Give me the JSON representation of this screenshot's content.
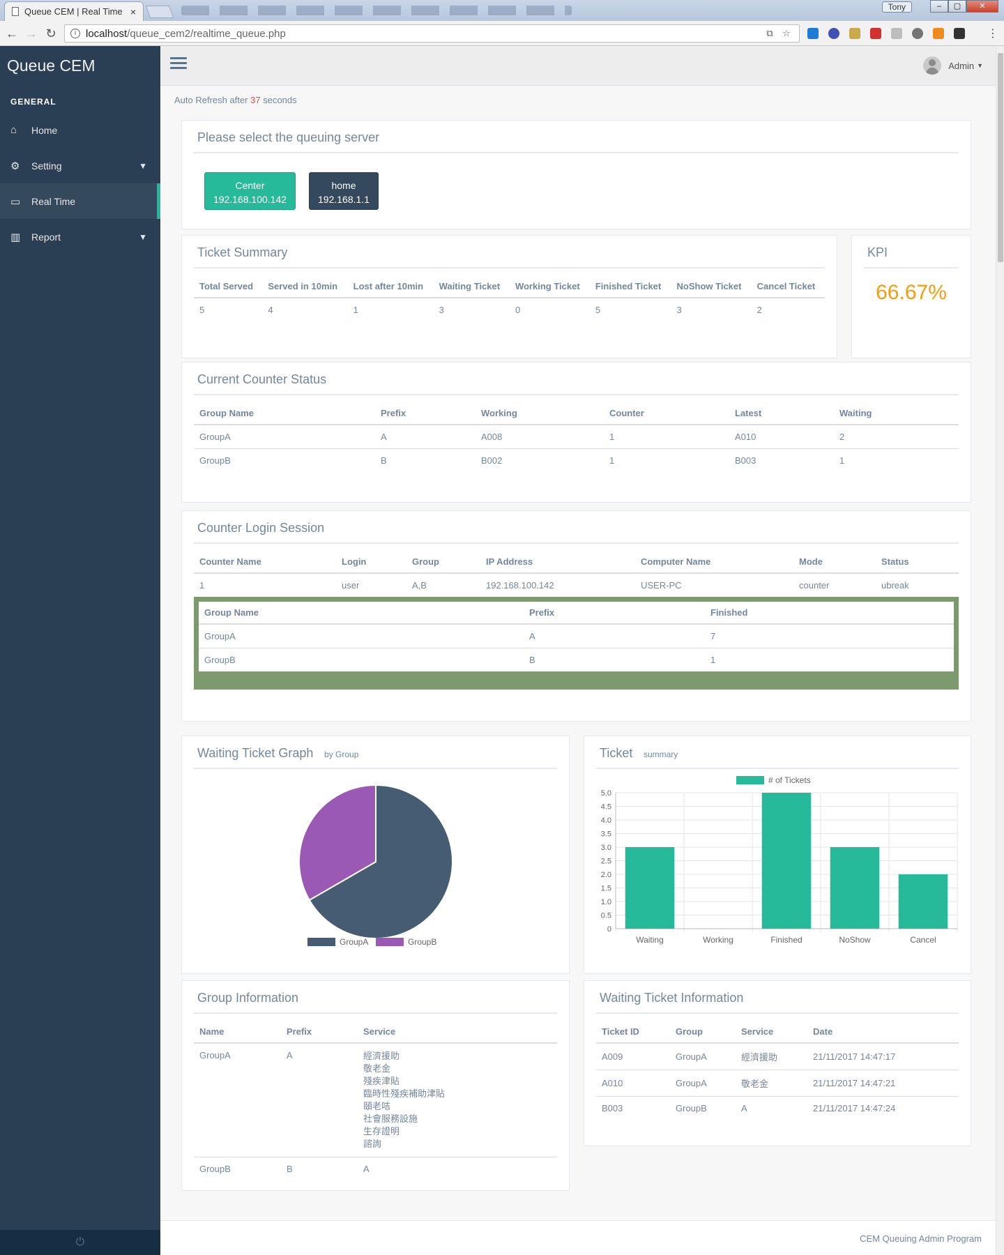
{
  "browser": {
    "tab_title": "Queue CEM | Real Time",
    "tab_close": "×",
    "user": "Tony",
    "window_controls": {
      "min": "–",
      "max": "▢",
      "close": "✕"
    },
    "url_host": "localhost",
    "url_path": "/queue_cem2/realtime_queue.php"
  },
  "sidebar": {
    "brand": "Queue CEM",
    "section": "General",
    "items": [
      {
        "label": "Home",
        "icon": "home-icon"
      },
      {
        "label": "Setting",
        "icon": "gear-icon"
      },
      {
        "label": "Real Time",
        "icon": "desktop-icon"
      },
      {
        "label": "Report",
        "icon": "bar-chart-icon"
      }
    ]
  },
  "topnav": {
    "user": "Admin"
  },
  "refresh": {
    "prefix": "Auto Refresh after",
    "seconds": "37",
    "suffix": "seconds"
  },
  "server_panel": {
    "title": "Please select the queuing server",
    "servers": [
      {
        "name": "Center",
        "ip": "192.168.100.142"
      },
      {
        "name": "home",
        "ip": "192.168.1.1"
      }
    ]
  },
  "ticket_summary": {
    "title": "Ticket Summary",
    "headers": [
      "Total Served",
      "Served in 10min",
      "Lost after 10min",
      "Waiting Ticket",
      "Working Ticket",
      "Finished Ticket",
      "NoShow Ticket",
      "Cancel Ticket"
    ],
    "values": [
      "5",
      "4",
      "1",
      "3",
      "0",
      "5",
      "3",
      "2"
    ]
  },
  "kpi": {
    "title": "KPI",
    "value": "66.67%"
  },
  "counter_status": {
    "title": "Current Counter Status",
    "headers": [
      "Group Name",
      "Prefix",
      "Working",
      "Counter",
      "Latest",
      "Waiting"
    ],
    "rows": [
      [
        "GroupA",
        "A",
        "A008",
        "1",
        "A010",
        "2"
      ],
      [
        "GroupB",
        "B",
        "B002",
        "1",
        "B003",
        "1"
      ]
    ]
  },
  "login_session": {
    "title": "Counter Login Session",
    "headers": [
      "Counter Name",
      "Login",
      "Group",
      "IP Address",
      "Computer Name",
      "Mode",
      "Status"
    ],
    "row": [
      "1",
      "user",
      "A,B",
      "192.168.100.142",
      "USER-PC",
      "counter",
      "ubreak"
    ],
    "sub_headers": [
      "Group Name",
      "Prefix",
      "Finished"
    ],
    "sub_rows": [
      [
        "GroupA",
        "A",
        "7"
      ],
      [
        "GroupB",
        "B",
        "1"
      ]
    ]
  },
  "waiting_graph": {
    "title": "Waiting Ticket Graph",
    "subtitle": "by Group"
  },
  "ticket_chart": {
    "title": "Ticket",
    "subtitle": "summary"
  },
  "colors": {
    "groupA": "#455C73",
    "groupB": "#9B59B6",
    "bar": "#26B99A",
    "kpi": "#F39C12"
  },
  "chart_data": [
    {
      "type": "pie",
      "categories": [
        "GroupA",
        "GroupB"
      ],
      "values": [
        2,
        1
      ]
    },
    {
      "type": "bar",
      "categories": [
        "Waiting",
        "Working",
        "Finished",
        "NoShow",
        "Cancel"
      ],
      "series": [
        {
          "name": "# of Tickets",
          "values": [
            3,
            0,
            5,
            3,
            2
          ]
        }
      ],
      "ylim": [
        0,
        5
      ],
      "yticks": [
        "0",
        "0.5",
        "1.0",
        "1.5",
        "2.0",
        "2.5",
        "3.0",
        "3.5",
        "4.0",
        "4.5",
        "5.0"
      ],
      "legend": "top"
    }
  ],
  "group_info": {
    "title": "Group Information",
    "headers": [
      "Name",
      "Prefix",
      "Service"
    ],
    "rows": [
      {
        "name": "GroupA",
        "prefix": "A",
        "services": [
          "經濟援助",
          "敬老金",
          "殘疾津貼",
          "臨時性殘疾補助津貼",
          "頤老咭",
          "社會服務設施",
          "生存證明",
          "諮詢"
        ]
      },
      {
        "name": "GroupB",
        "prefix": "B",
        "services": [
          "A"
        ]
      }
    ]
  },
  "waiting_info": {
    "title": "Waiting Ticket Information",
    "headers": [
      "Ticket ID",
      "Group",
      "Service",
      "Date"
    ],
    "rows": [
      [
        "A009",
        "GroupA",
        "經濟援助",
        "21/11/2017 14:47:17"
      ],
      [
        "A010",
        "GroupA",
        "敬老金",
        "21/11/2017 14:47:21"
      ],
      [
        "B003",
        "GroupB",
        "A",
        "21/11/2017 14:47:24"
      ]
    ]
  },
  "footer": "CEM Queuing Admin Program"
}
